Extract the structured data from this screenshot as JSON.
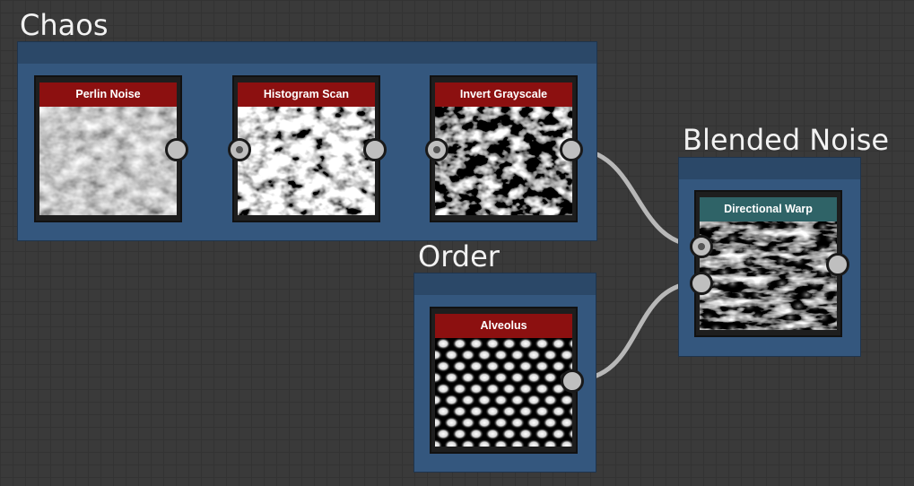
{
  "frames": {
    "chaos": {
      "title": "Chaos"
    },
    "order": {
      "title": "Order"
    },
    "blended": {
      "title": "Blended Noise"
    }
  },
  "nodes": {
    "perlin": {
      "label": "Perlin Noise"
    },
    "histogram": {
      "label": "Histogram Scan"
    },
    "invert": {
      "label": "Invert Grayscale"
    },
    "alveolus": {
      "label": "Alveolus"
    },
    "warp": {
      "label": "Directional Warp"
    }
  },
  "colors": {
    "canvas": "#3a3a3a",
    "frame": "#34577e",
    "node_header_red": "#8c1010",
    "node_header_teal": "#2f6367",
    "wire": "#b8b8b8"
  }
}
